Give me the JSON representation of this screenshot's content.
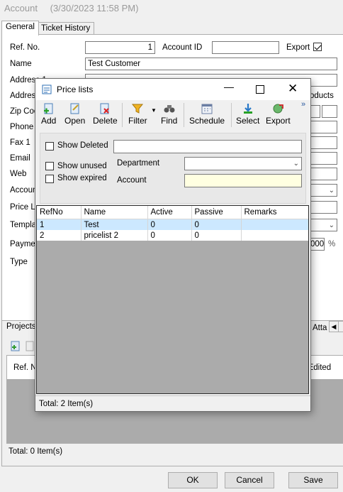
{
  "window": {
    "title": "Account",
    "timestamp": "(3/30/2023 11:58 PM)"
  },
  "tabs": [
    "General",
    "Ticket History"
  ],
  "form": {
    "ref_no_label": "Ref. No.",
    "ref_no_value": "1",
    "account_id_label": "Account ID",
    "account_id_value": "",
    "export_label": "Export",
    "export_checked": true,
    "name_label": "Name",
    "name_value": "Test Customer",
    "address1_label": "Address 1",
    "address2_label": "Address",
    "zip_label": "Zip Cod",
    "phone_label": "Phone",
    "fax_label": "Fax 1",
    "email_label": "Email",
    "web_label": "Web",
    "account_label": "Accoun",
    "pricelist_label": "Price Li",
    "template_label": "Templat",
    "payment_label": "Payme",
    "payment_value": "000",
    "percent_symbol": "%",
    "type_label": "Type",
    "products_label": "oducts"
  },
  "projects": {
    "tab_label": "Projects",
    "attach_label": "Atta",
    "col_ref": "Ref. N",
    "col_edited": "d Edited",
    "status": "Total: 0 Item(s)"
  },
  "dialog": {
    "title": "Price lists",
    "toolbar": [
      {
        "label": "Add",
        "icon": "add-document-icon"
      },
      {
        "label": "Open",
        "icon": "open-document-icon"
      },
      {
        "label": "Delete",
        "icon": "delete-document-icon"
      },
      {
        "label": "Filter",
        "icon": "filter-funnel-icon"
      },
      {
        "label": "Find",
        "icon": "binoculars-icon"
      },
      {
        "label": "Schedule",
        "icon": "calendar-icon"
      },
      {
        "label": "Select",
        "icon": "select-arrow-icon"
      },
      {
        "label": "Export",
        "icon": "export-globe-icon"
      }
    ],
    "overflow": "»",
    "filters": {
      "show_deleted": "Show Deleted",
      "show_unused": "Show unused",
      "show_expired": "Show expired",
      "department_label": "Department",
      "account_label": "Account"
    },
    "columns": [
      "RefNo",
      "Name",
      "Active",
      "Passive",
      "Remarks"
    ],
    "rows": [
      {
        "refno": "1",
        "name": "Test",
        "active": "0",
        "passive": "0",
        "remarks": ""
      },
      {
        "refno": "2",
        "name": "pricelist 2",
        "active": "0",
        "passive": "0",
        "remarks": ""
      }
    ],
    "status": "Total: 2 Item(s)"
  },
  "buttons": {
    "ok": "OK",
    "cancel": "Cancel",
    "save": "Save"
  }
}
